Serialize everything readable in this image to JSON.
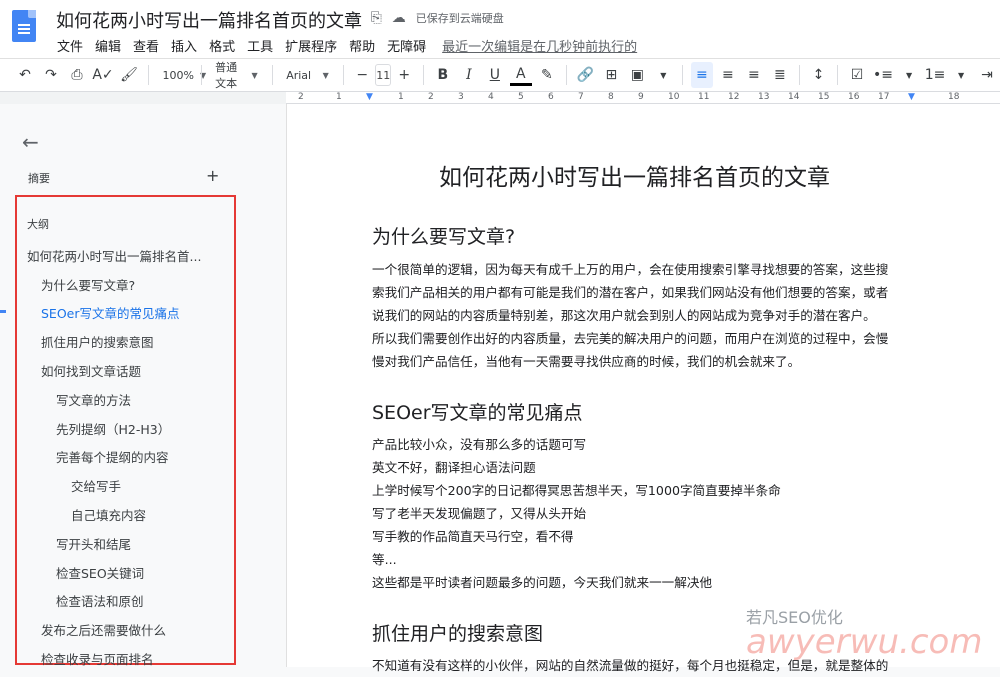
{
  "app": {
    "title": "如何花两小时写出一篇排名首页的文章",
    "saved_status": "已保存到云端硬盘"
  },
  "menu": [
    "文件",
    "编辑",
    "查看",
    "插入",
    "格式",
    "工具",
    "扩展程序",
    "帮助",
    "无障碍"
  ],
  "last_edit": "最近一次编辑是在几秒钟前执行的",
  "toolbar": {
    "zoom": "100%",
    "style": "普通文本",
    "font": "Arial",
    "font_size": "11"
  },
  "ruler_marks": [
    "2",
    "1",
    "1",
    "2",
    "3",
    "4",
    "5",
    "6",
    "7",
    "8",
    "9",
    "10",
    "11",
    "12",
    "13",
    "14",
    "15",
    "16",
    "17",
    "18"
  ],
  "sidebar": {
    "summary_label": "摘要",
    "outline_label": "大纲",
    "items": [
      {
        "label": "如何花两小时写出一篇排名首..."
      },
      {
        "label": "为什么要写文章?"
      },
      {
        "label": "SEOer写文章的常见痛点"
      },
      {
        "label": "抓住用户的搜索意图"
      },
      {
        "label": "如何找到文章话题"
      },
      {
        "label": "写文章的方法"
      },
      {
        "label": "先列提纲（H2-H3）"
      },
      {
        "label": "完善每个提纲的内容"
      },
      {
        "label": "交给写手"
      },
      {
        "label": "自己填充内容"
      },
      {
        "label": "写开头和结尾"
      },
      {
        "label": "检查SEO关键词"
      },
      {
        "label": "检查语法和原创"
      },
      {
        "label": "发布之后还需要做什么"
      },
      {
        "label": "检查收录与页面排名"
      }
    ]
  },
  "document": {
    "title": "如何花两小时写出一篇排名首页的文章",
    "section1": {
      "heading": "为什么要写文章?",
      "lines": [
        "一个很简单的逻辑，因为每天有成千上万的用户，会在使用搜索引擎寻找想要的答案，这些搜",
        "索我们产品相关的用户都有可能是我们的潜在客户，如果我们网站没有他们想要的答案，或者",
        "说我们的网站的内容质量特别差，那这次用户就会到别人的网站成为竞争对手的潜在客户。",
        "所以我们需要创作出好的内容质量，去完美的解决用户的问题，而用户在浏览的过程中，会慢",
        "慢对我们产品信任，当他有一天需要寻找供应商的时候，我们的机会就来了。"
      ]
    },
    "section2": {
      "heading": "SEOer写文章的常见痛点",
      "lines": [
        "产品比较小众，没有那么多的话题可写",
        "英文不好，翻译担心语法问题",
        "上学时候写个200字的日记都得冥思苦想半天，写1000字简直要掉半条命",
        "写了老半天发现偏题了，又得从头开始",
        "写手教的作品简直天马行空，看不得",
        "等...",
        "这些都是平时读者问题最多的问题，今天我们就来一一解决他"
      ]
    },
    "section3": {
      "heading": "抓住用户的搜索意图",
      "lines": [
        "不知道有没有这样的小伙伴，网站的自然流量做的挺好，每个月也挺稳定，但是，就是整体的"
      ]
    }
  },
  "watermark": {
    "account": "若凡SEO优化",
    "url": "awyerwu.com"
  }
}
